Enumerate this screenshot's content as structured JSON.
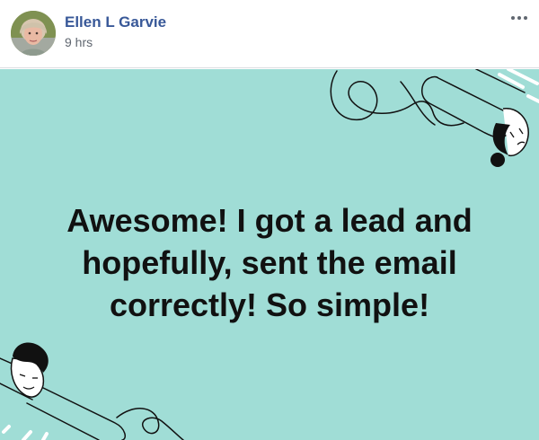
{
  "post": {
    "author": {
      "name": "Ellen L Garvie",
      "avatar_icon": "profile-photo"
    },
    "timestamp": "9 hrs",
    "menu_icon": "more-options-icon",
    "background_color": "#a0ddd6",
    "text": "Awesome! I got a lead and hopefully, sent the email correctly! So simple!"
  }
}
